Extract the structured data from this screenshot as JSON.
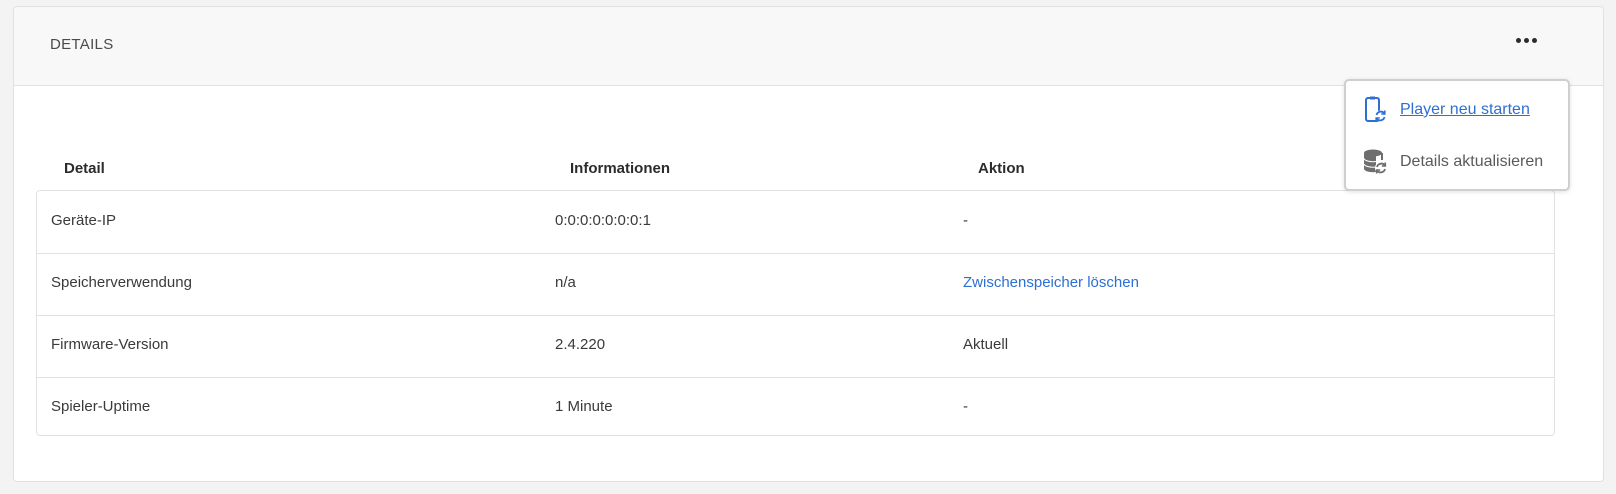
{
  "header": {
    "title": "DETAILS"
  },
  "more_menu": {
    "items": [
      {
        "label": "Player neu starten",
        "icon": "device-refresh-icon"
      },
      {
        "label": "Details aktualisieren",
        "icon": "database-refresh-icon"
      }
    ]
  },
  "table": {
    "columns": [
      "Detail",
      "Informationen",
      "Aktion"
    ],
    "rows": [
      {
        "detail": "Geräte-IP",
        "info": "0:0:0:0:0:0:0:1",
        "action": "-"
      },
      {
        "detail": "Speicherverwendung",
        "info": "n/a",
        "action": "Zwischenspeicher löschen"
      },
      {
        "detail": "Firmware-Version",
        "info": "2.4.220",
        "action": "Aktuell"
      },
      {
        "detail": "Spieler-Uptime",
        "info": "1 Minute",
        "action": "-"
      }
    ]
  },
  "colors": {
    "link": "#2d6fd2",
    "icon_blue": "#2d6fd2",
    "icon_gray": "#6e6e6e"
  }
}
